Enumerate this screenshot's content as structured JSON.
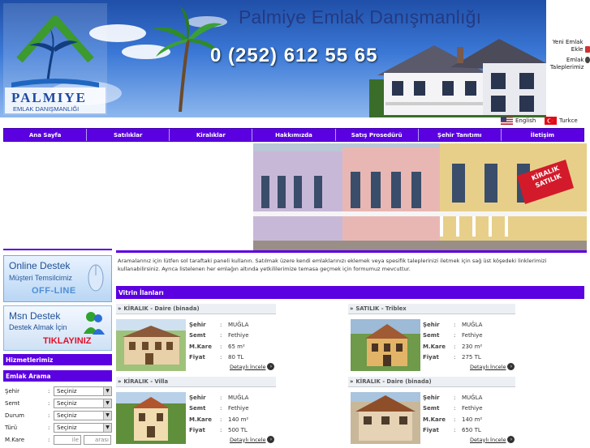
{
  "header": {
    "brand_title": "Palmiye Emlak Danışmanlığı",
    "phone": "0 (252) 612 55 65",
    "logo_name": "PALMIYE",
    "logo_sub": "EMLAK DANIŞMANLIĞI"
  },
  "right_links": [
    {
      "label": "Yeni Emlak Ekle",
      "icon": "home-add-icon"
    },
    {
      "label": "Emlak Taleplerimiz",
      "icon": "people-icon"
    }
  ],
  "languages": [
    {
      "label": "English",
      "icon": "us-flag-icon"
    },
    {
      "label": "Turkce",
      "icon": "turkey-flag-icon"
    }
  ],
  "nav": [
    "Ana Sayfa",
    "Satılıklar",
    "Kiralıklar",
    "Hakkımızda",
    "Satış Prosedürü",
    "Şehir Tanıtımı",
    "İletişim"
  ],
  "banner_badge": "KİRALIK SATILIK",
  "support": {
    "online_title": "Online Destek",
    "online_sub": "Müşteri Temsilcimiz",
    "online_status": "OFF-LINE",
    "msn_title": "Msn Destek",
    "msn_sub": "Destek Almak İçin",
    "msn_action": "TIKLAYINIZ"
  },
  "services_title": "Hizmetlerimiz",
  "search": {
    "title": "Emlak Arama",
    "fields": [
      {
        "label": "Şehir",
        "value": "Seçiniz"
      },
      {
        "label": "Semt",
        "value": "Seçiniz"
      },
      {
        "label": "Durum",
        "value": "Seçiniz"
      },
      {
        "label": "Türü",
        "value": "Seçiniz"
      }
    ],
    "mkare_label": "M.Kare",
    "mkare_ile": "ile",
    "mkare_arasi": "arası"
  },
  "intro_text": "Aramalarınız için lütfen sol taraftaki paneli kullanın. Satılmak üzere kendi emlaklarınızı eklemek veya spesifik taleplerinizi iletmek için sağ üst köşedeki linklerimizi kullanabilirsiniz. Ayrıca listelenen her emlağın altında yetkililerimize temasa geçmek için formumuz mevcuttur.",
  "vitrin_title": "Vitrin İlanları",
  "listing_labels": {
    "city": "Şehir",
    "district": "Semt",
    "area": "M.Kare",
    "price": "Fiyat",
    "details": "Detaylı İncele"
  },
  "listings": [
    {
      "title": "KİRALIK - Daire (binada)",
      "city": "MUĞLA",
      "district": "Fethiye",
      "area": "65 m²",
      "price": "80 TL"
    },
    {
      "title": "SATILIK - Triblex",
      "city": "MUĞLA",
      "district": "Fethiye",
      "area": "230 m²",
      "price": "275 TL"
    },
    {
      "title": "KİRALIK - Villa",
      "city": "MUĞLA",
      "district": "Fethiye",
      "area": "140 m²",
      "price": "500 TL"
    },
    {
      "title": "KİRALIK - Daire (binada)",
      "city": "MUĞLA",
      "district": "Fethiye",
      "area": "140 m²",
      "price": "650 TL"
    }
  ],
  "colors": {
    "accent": "#5b00e0",
    "header_blue": "#1f4fa8",
    "msn_red": "#e0102a"
  }
}
